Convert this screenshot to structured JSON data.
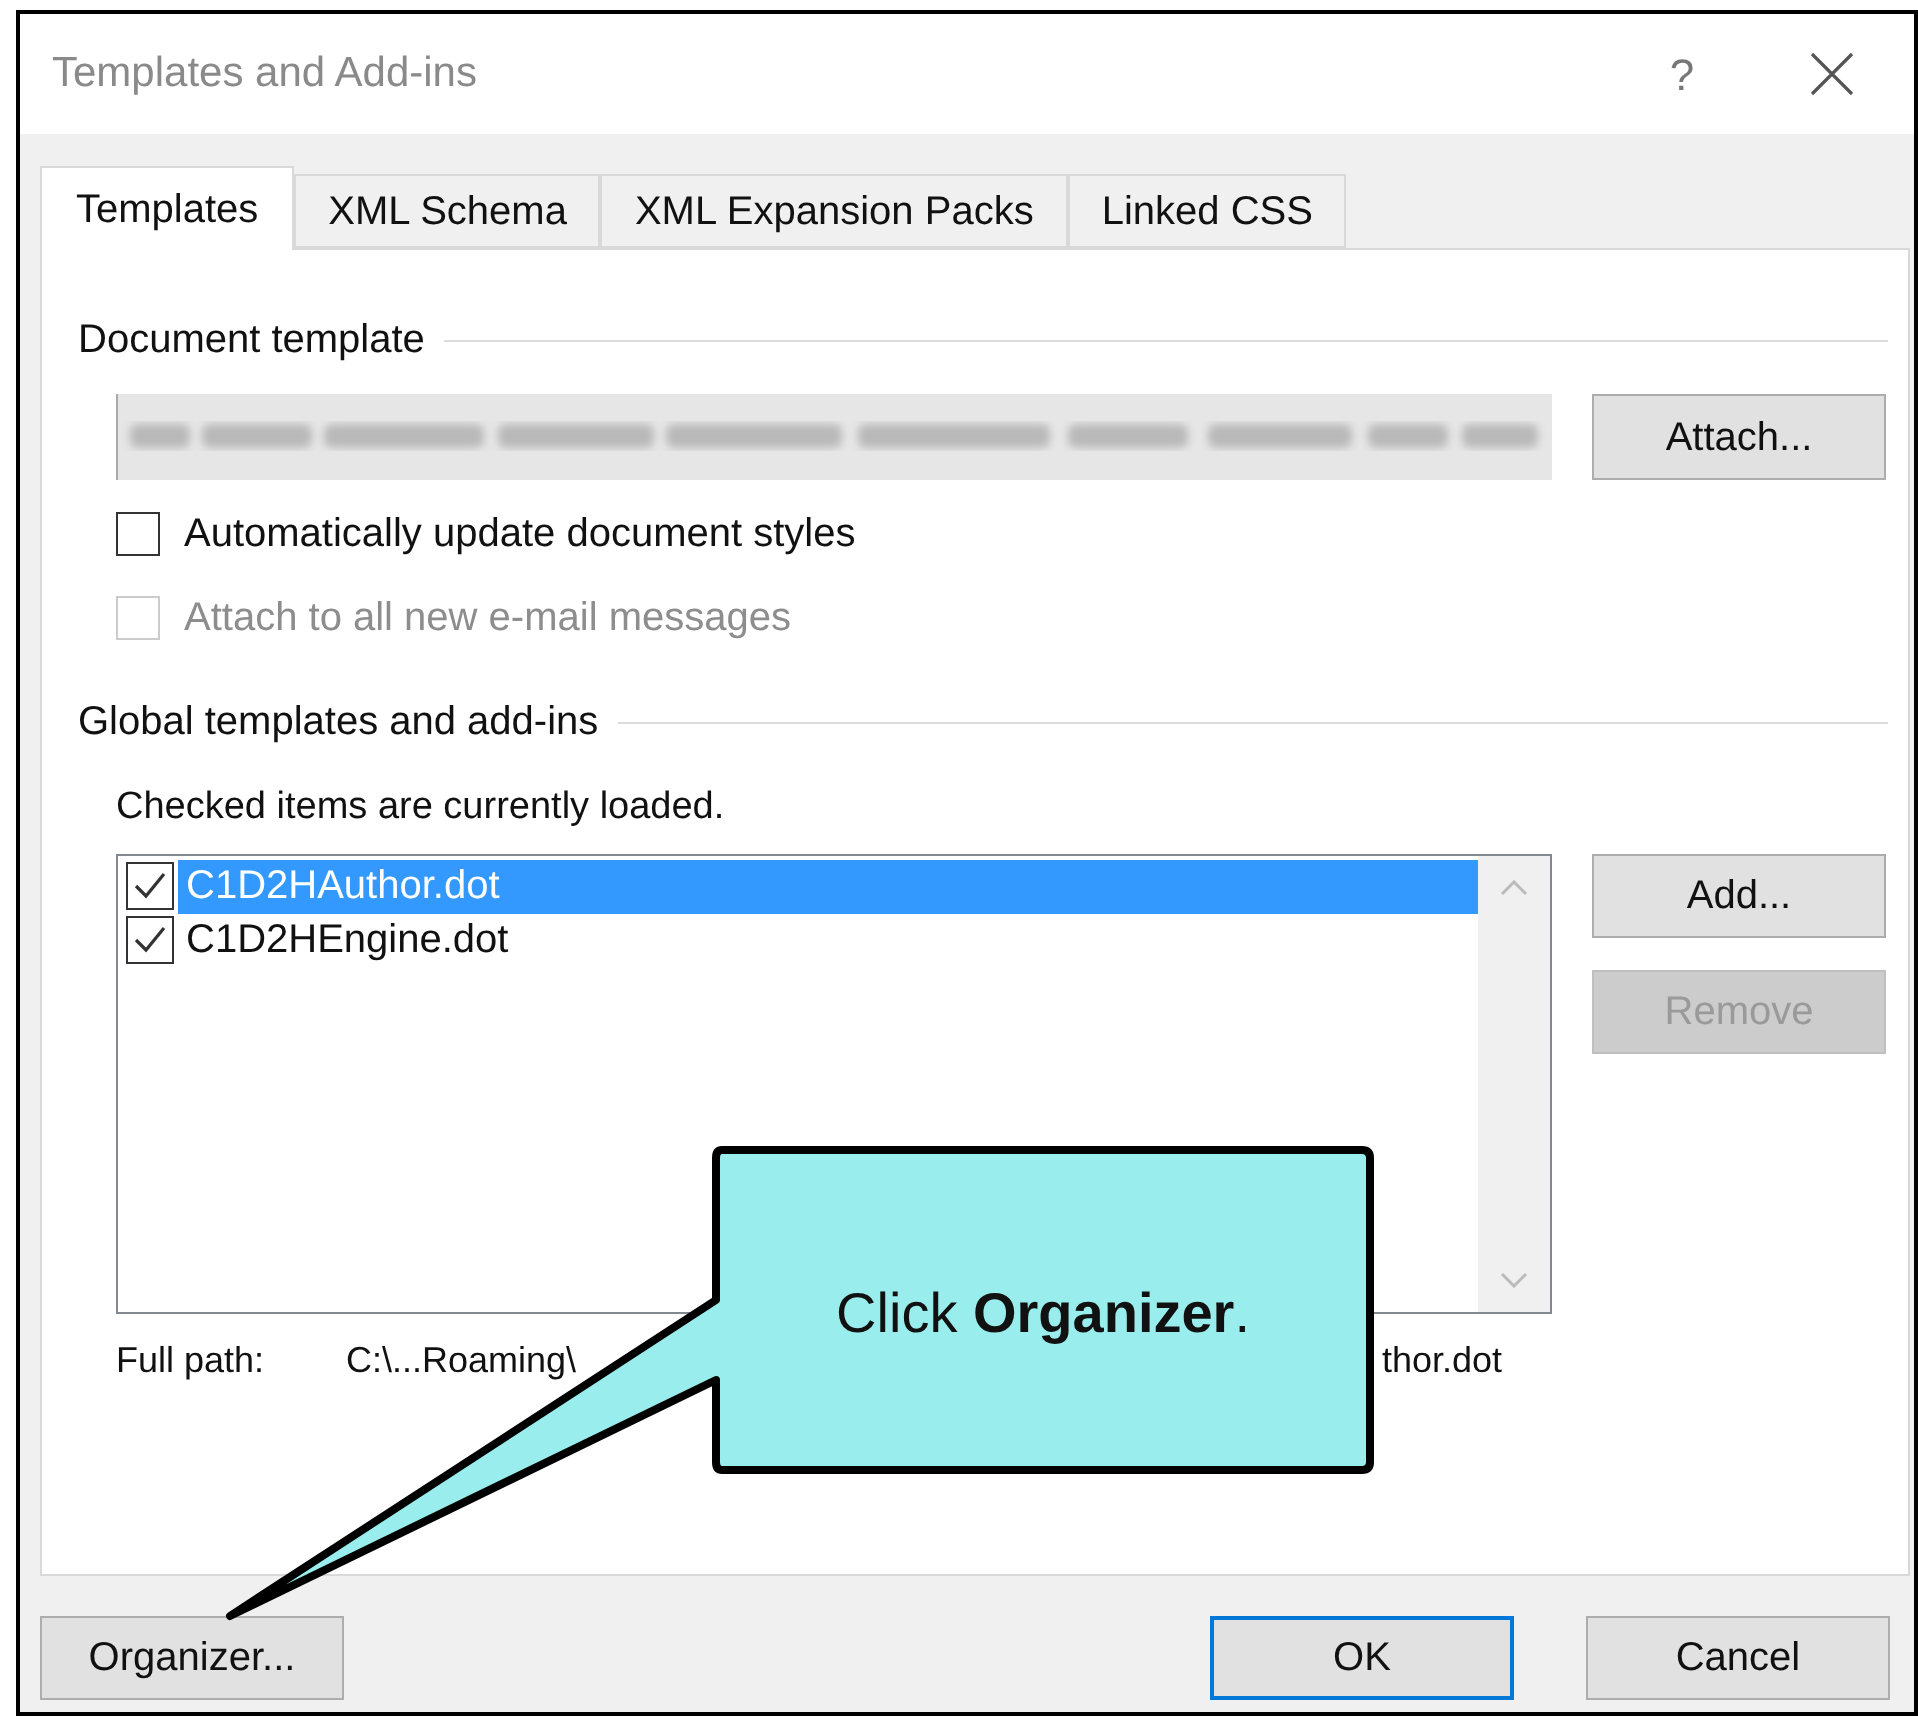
{
  "window": {
    "title": "Templates and Add-ins",
    "help": "?"
  },
  "tabs": [
    {
      "label": "Templates",
      "selected": true
    },
    {
      "label": "XML Schema",
      "selected": false
    },
    {
      "label": "XML Expansion Packs",
      "selected": false
    },
    {
      "label": "Linked CSS",
      "selected": false
    }
  ],
  "document_template": {
    "heading": "Document template",
    "attach_button": "Attach...",
    "options": [
      {
        "label": "Automatically update document styles",
        "checked": false,
        "disabled": false
      },
      {
        "label": "Attach to all new e-mail messages",
        "checked": false,
        "disabled": true
      }
    ]
  },
  "global_templates": {
    "heading": "Global templates and add-ins",
    "note": "Checked items are currently loaded.",
    "items": [
      {
        "label": "C1D2HAuthor.dot",
        "checked": true,
        "selected": true
      },
      {
        "label": "C1D2HEngine.dot",
        "checked": true,
        "selected": false
      }
    ],
    "add_button": {
      "label": "Add...",
      "disabled": false
    },
    "remove_button": {
      "label": "Remove",
      "disabled": true
    },
    "full_path": {
      "label": "Full path:",
      "visible_parts": [
        "C:\\...Roaming\\",
        "thor.dot"
      ]
    }
  },
  "callout": {
    "text": "Click **Organizer**."
  },
  "buttons": [
    {
      "label": "Organizer...",
      "default": false
    },
    {
      "label": "OK",
      "default": true
    },
    {
      "label": "Cancel",
      "default": false
    }
  ]
}
